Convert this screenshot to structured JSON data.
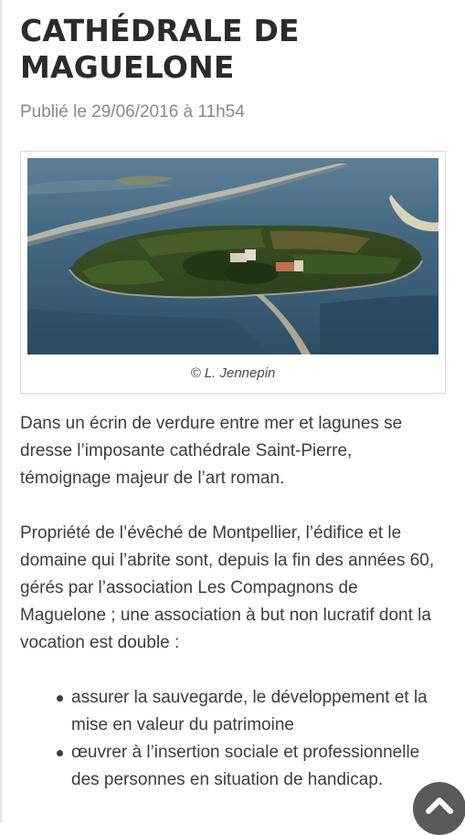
{
  "article": {
    "title": "CATHÉDRALE DE MAGUELONE",
    "published": "Publié le 29/06/2016 à 11h54",
    "figure": {
      "caption": "© L. Jennepin"
    },
    "paragraphs": [
      "Dans un écrin de verdure entre mer et lagunes se dresse l’imposante cathédrale Saint-Pierre, témoignage majeur de l’art roman.",
      "Propriété de l’évêché de Montpellier, l’édifice et le domaine qui l’abrite sont, depuis la fin des années 60, gérés par l’association Les Compagnons de Maguelone ; une association à but non lucratif dont la vocation est double :"
    ],
    "bullets": [
      "assurer la sauvegarde, le développement et la mise en valeur du patrimoine",
      "œuvrer à l’insertion sociale et professionnelle des personnes en situation de handicap."
    ]
  },
  "scroll_top": {
    "icon": "chevron-up-icon",
    "color": "#5a5a5a"
  }
}
